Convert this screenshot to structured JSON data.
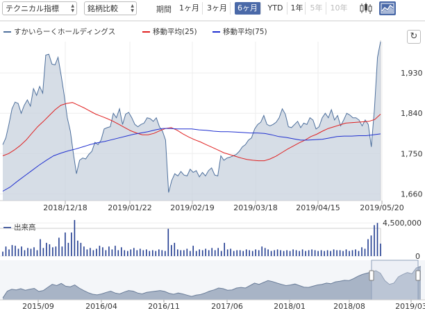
{
  "toolbar": {
    "indicator_select": "テクニカル指標",
    "compare_select": "銘柄比較",
    "period_label": "期間",
    "periods": [
      {
        "label": "1ヶ月",
        "state": "normal"
      },
      {
        "label": "3ヶ月",
        "state": "normal"
      },
      {
        "label": "6ヶ月",
        "state": "active"
      },
      {
        "label": "YTD",
        "state": "normal"
      },
      {
        "label": "1年",
        "state": "normal"
      },
      {
        "label": "5年",
        "state": "disabled"
      },
      {
        "label": "10年",
        "state": "disabled"
      }
    ],
    "icons": [
      "candlestick-icon",
      "area-chart-icon"
    ],
    "active_icon": "area-chart-icon"
  },
  "legend": {
    "price": "すかいらーくホールディングス",
    "ma25": "移動平均(25)",
    "ma75": "移動平均(75)"
  },
  "volume_label": "出来高",
  "colors": {
    "price_line": "#4d6f9c",
    "price_fill": "#c8d1de",
    "ma25": "#e02020",
    "ma75": "#1f2fd0",
    "volume": "#1f3a8f",
    "nav_fill": "#9aa8bd",
    "accent": "#4a69a8"
  },
  "chart_data": [
    {
      "type": "area",
      "title": "",
      "x_ticks": [
        "2018/12/18",
        "2019/01/22",
        "2019/02/19",
        "2019/03/18",
        "2019/04/15",
        "2019/05/20"
      ],
      "y_ticks": [
        1660,
        1750,
        1840,
        1930
      ],
      "ylim": [
        1645,
        2000
      ],
      "grid": true,
      "legend_position": "top-left",
      "series": [
        {
          "name": "すかいらーくホールディングス",
          "values": [
            1770,
            1785,
            1815,
            1850,
            1865,
            1862,
            1840,
            1858,
            1870,
            1856,
            1895,
            1880,
            1900,
            1885,
            1970,
            1972,
            1950,
            1948,
            1965,
            1925,
            1880,
            1830,
            1800,
            1750,
            1705,
            1735,
            1740,
            1738,
            1748,
            1755,
            1775,
            1770,
            1780,
            1805,
            1808,
            1810,
            1840,
            1830,
            1850,
            1815,
            1838,
            1842,
            1830,
            1815,
            1810,
            1815,
            1818,
            1830,
            1828,
            1822,
            1830,
            1810,
            1800,
            1780,
            1663,
            1690,
            1705,
            1700,
            1710,
            1702,
            1700,
            1715,
            1708,
            1712,
            1698,
            1708,
            1700,
            1712,
            1718,
            1702,
            1700,
            1745,
            1735,
            1740,
            1742,
            1745,
            1748,
            1755,
            1765,
            1770,
            1780,
            1785,
            1805,
            1815,
            1820,
            1835,
            1815,
            1812,
            1815,
            1820,
            1830,
            1850,
            1838,
            1810,
            1808,
            1815,
            1822,
            1808,
            1818,
            1815,
            1830,
            1825,
            1805,
            1810,
            1830,
            1840,
            1830,
            1848,
            1825,
            1835,
            1812,
            1825,
            1840,
            1836,
            1830,
            1830,
            1825,
            1812,
            1825,
            1815,
            1765,
            1850,
            1965,
            2000
          ],
          "ylim": [
            1645,
            2000
          ]
        },
        {
          "name": "移動平均(25)",
          "values": [
            1745,
            1750,
            1758,
            1768,
            1780,
            1795,
            1810,
            1822,
            1835,
            1848,
            1858,
            1862,
            1864,
            1858,
            1852,
            1845,
            1838,
            1833,
            1828,
            1822,
            1815,
            1808,
            1801,
            1796,
            1792,
            1792,
            1795,
            1801,
            1806,
            1808,
            1802,
            1794,
            1787,
            1781,
            1776,
            1770,
            1764,
            1758,
            1752,
            1748,
            1744,
            1740,
            1737,
            1735,
            1734,
            1734,
            1738,
            1744,
            1752,
            1760,
            1767,
            1774,
            1780,
            1788,
            1793,
            1800,
            1806,
            1810,
            1814,
            1818,
            1819,
            1820,
            1821,
            1822,
            1826,
            1838
          ],
          "ylim": [
            1645,
            2000
          ]
        },
        {
          "name": "移動平均(75)",
          "values": [
            1666,
            1675,
            1688,
            1700,
            1712,
            1724,
            1735,
            1745,
            1751,
            1756,
            1760,
            1765,
            1770,
            1774,
            1777,
            1781,
            1785,
            1789,
            1793,
            1796,
            1799,
            1803,
            1806,
            1806,
            1805,
            1805,
            1805,
            1803,
            1802,
            1800,
            1799,
            1799,
            1798,
            1797,
            1796,
            1796,
            1795,
            1792,
            1788,
            1786,
            1783,
            1780,
            1780,
            1781,
            1782,
            1785,
            1788,
            1789,
            1789,
            1790,
            1790,
            1792,
            1794
          ],
          "ylim": [
            1645,
            2000
          ]
        }
      ]
    },
    {
      "type": "bar",
      "title": "出来高",
      "y_ticks": [
        0,
        4500000
      ],
      "ylim": [
        0,
        4900000
      ],
      "series": [
        {
          "name": "出来高",
          "values": [
            600000,
            1300000,
            900000,
            1500000,
            1400000,
            1000000,
            1300000,
            800000,
            1100000,
            1000000,
            1200000,
            800000,
            2300000,
            1100000,
            1800000,
            1600000,
            1200000,
            1300000,
            2500000,
            1300000,
            3200000,
            1800000,
            3200000,
            4900000,
            2100000,
            1800000,
            1300000,
            900000,
            1100000,
            800000,
            1000000,
            1400000,
            1200000,
            800000,
            1300000,
            900000,
            1400000,
            800000,
            1200000,
            800000,
            700000,
            900000,
            1100000,
            800000,
            1000000,
            800000,
            900000,
            700000,
            800000,
            700000,
            900000,
            800000,
            700000,
            3700000,
            1500000,
            1800000,
            900000,
            800000,
            800000,
            1000000,
            700000,
            1400000,
            700000,
            900000,
            800000,
            1000000,
            800000,
            1100000,
            800000,
            1100000,
            700000,
            1800000,
            900000,
            1000000,
            700000,
            800000,
            800000,
            700000,
            900000,
            800000,
            700000,
            900000,
            800000,
            1300000,
            1100000,
            900000,
            700000,
            800000,
            900000,
            800000,
            700000,
            800000,
            700000,
            900000,
            800000,
            700000,
            900000,
            700000,
            800000,
            900000,
            800000,
            700000,
            800000,
            700000,
            800000,
            700000,
            900000,
            800000,
            800000,
            700000,
            900000,
            700000,
            800000,
            900000,
            700000,
            1200000,
            1000000,
            2300000,
            2800000,
            4200000,
            4500000,
            1700000
          ]
        }
      ]
    },
    {
      "type": "area",
      "title": "",
      "x_ticks": [
        "2015/09",
        "2016/04",
        "2016/11",
        "2017/06",
        "2018/01",
        "2018/08",
        "2019/03"
      ],
      "series": [
        {
          "name": "",
          "values": [
            1480,
            1590,
            1620,
            1610,
            1630,
            1605,
            1620,
            1635,
            1585,
            1600,
            1650,
            1700,
            1680,
            1715,
            1670,
            1660,
            1690,
            1640,
            1600,
            1565,
            1540,
            1530,
            1545,
            1570,
            1590,
            1560,
            1545,
            1575,
            1600,
            1590,
            1560,
            1545,
            1570,
            1580,
            1590,
            1600,
            1585,
            1555,
            1540,
            1560,
            1545,
            1525,
            1505,
            1525,
            1535,
            1560,
            1590,
            1610,
            1640,
            1630,
            1605,
            1610,
            1640,
            1650,
            1640,
            1680,
            1720,
            1700,
            1730,
            1760,
            1745,
            1720,
            1700,
            1680,
            1690,
            1705,
            1680,
            1655,
            1650,
            1670,
            1690,
            1700,
            1720,
            1710,
            1740,
            1750,
            1765,
            1760,
            1790,
            1830,
            1860,
            1880,
            1900,
            1920,
            1880,
            1760,
            1700,
            1720,
            1820,
            1860,
            1890,
            1870,
            1965,
            1990
          ]
        }
      ]
    }
  ]
}
